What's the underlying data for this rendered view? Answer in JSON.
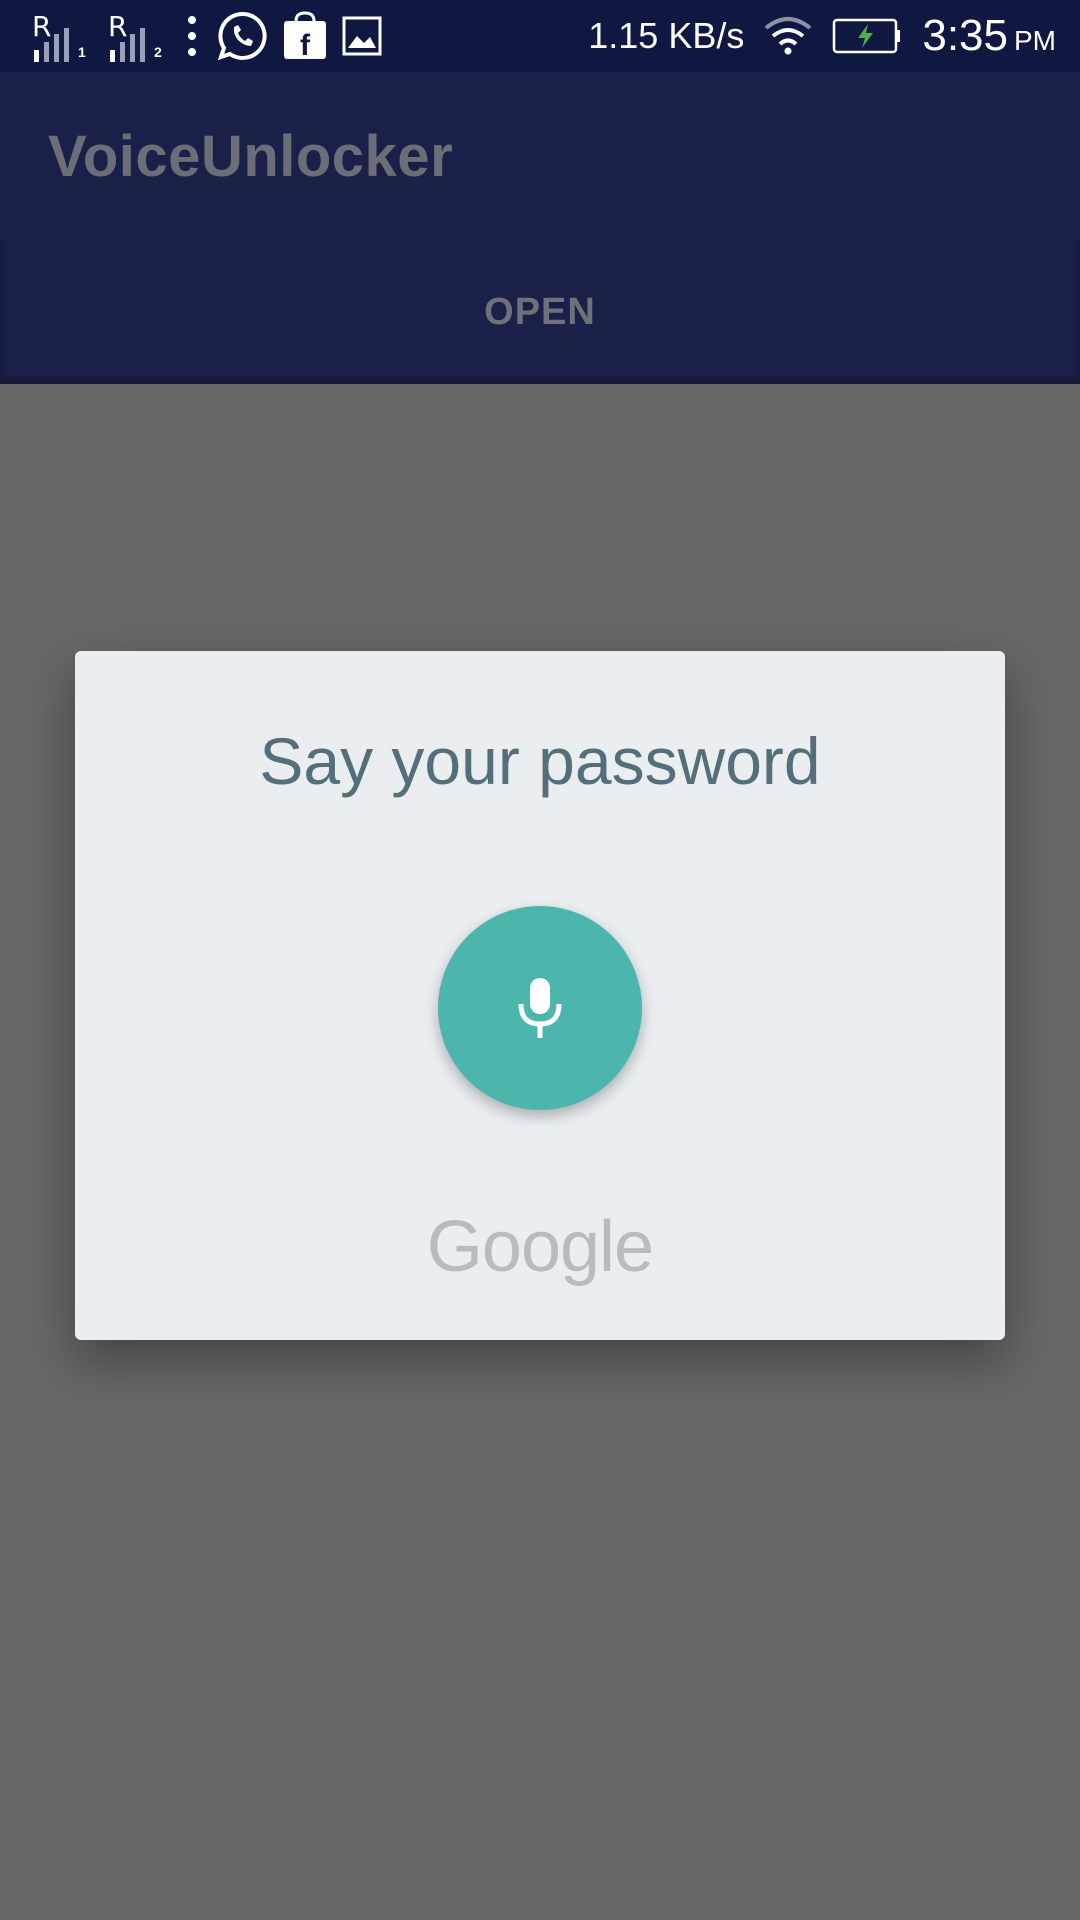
{
  "status_bar": {
    "sim1_label": "R",
    "sim1_index": "1",
    "sim2_label": "R",
    "sim2_index": "2",
    "net_speed": "1.15 KB/s",
    "time": "3:35",
    "ampm": "PM",
    "icons": [
      "signal-sim1-icon",
      "signal-sim2-icon",
      "more-vert-icon",
      "whatsapp-icon",
      "shopping-bag-icon",
      "image-icon",
      "wifi-icon",
      "battery-charging-icon"
    ]
  },
  "app_bar": {
    "title": "VoiceUnlocker"
  },
  "tabs": {
    "open_label": "OPEN"
  },
  "dialog": {
    "title": "Say your password",
    "mic_icon": "microphone-icon",
    "brand": "Google",
    "mic_color": "#4db6ac"
  },
  "colors": {
    "status_bar": "#101841",
    "app_bar": "#1a2048",
    "scrim": "#676767",
    "dialog_bg": "#ebeef0",
    "title_text": "#546e7a"
  }
}
